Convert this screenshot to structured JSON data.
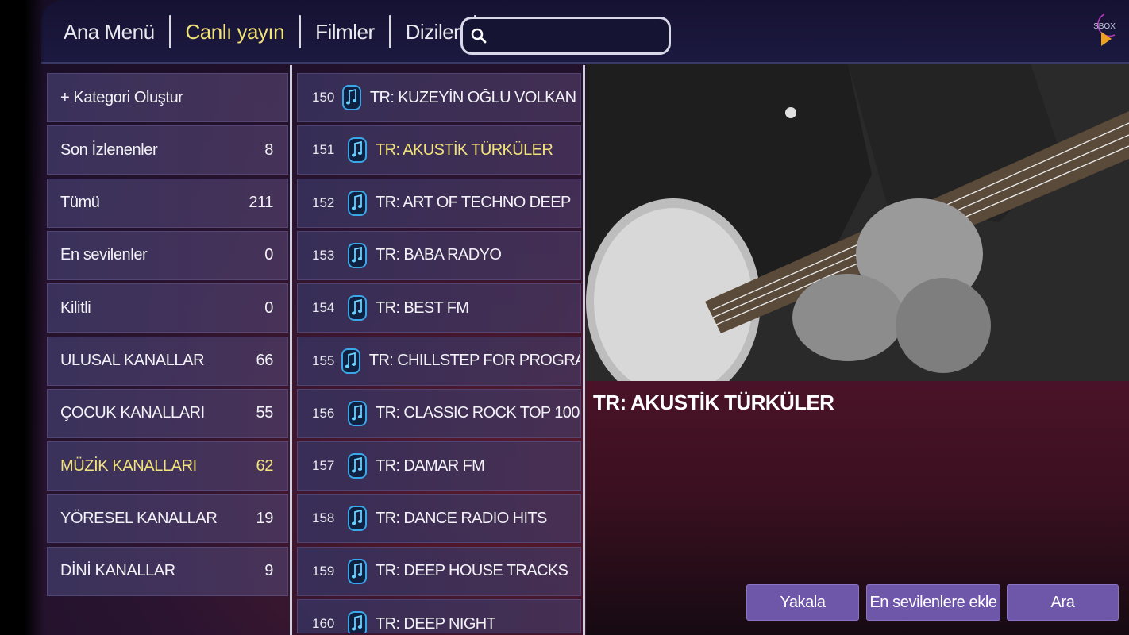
{
  "nav": {
    "items": [
      {
        "label": "Ana Menü"
      },
      {
        "label": "Canlı yayın"
      },
      {
        "label": "Filmler"
      },
      {
        "label": "Diziler"
      }
    ],
    "active_index": 1
  },
  "search": {
    "value": "",
    "placeholder": ""
  },
  "logo": {
    "text": "SBOX",
    "icon": "play-logo-icon"
  },
  "categories": [
    {
      "label": "+ Kategori Oluştur",
      "count": ""
    },
    {
      "label": "Son İzlenenler",
      "count": "8"
    },
    {
      "label": "Tümü",
      "count": "211"
    },
    {
      "label": "En sevilenler",
      "count": "0"
    },
    {
      "label": "Kilitli",
      "count": "0"
    },
    {
      "label": "ULUSAL KANALLAR",
      "count": "66"
    },
    {
      "label": "ÇOCUK KANALLARI",
      "count": "55"
    },
    {
      "label": "MÜZİK KANALLARI",
      "count": "62"
    },
    {
      "label": "YÖRESEL KANALLAR",
      "count": "19"
    },
    {
      "label": "DİNİ KANALLAR",
      "count": "9"
    }
  ],
  "active_category_index": 7,
  "channels": [
    {
      "number": "150",
      "name": "TR: KUZEYİN OĞLU VOLKAN KON..",
      "icon": "music-note-icon"
    },
    {
      "number": "151",
      "name": "TR: AKUSTİK TÜRKÜLER",
      "icon": "music-note-icon"
    },
    {
      "number": "152",
      "name": "TR: ART OF TECHNO DEEP",
      "icon": "music-note-icon"
    },
    {
      "number": "153",
      "name": "TR: BABA RADYO",
      "icon": "music-note-icon"
    },
    {
      "number": "154",
      "name": "TR: BEST FM",
      "icon": "music-note-icon"
    },
    {
      "number": "155",
      "name": "TR: CHILLSTEP FOR PROGRAMME..",
      "icon": "music-note-icon"
    },
    {
      "number": "156",
      "name": "TR: CLASSIC ROCK TOP 100",
      "icon": "music-note-icon"
    },
    {
      "number": "157",
      "name": "TR: DAMAR FM",
      "icon": "music-note-icon"
    },
    {
      "number": "158",
      "name": "TR: DANCE RADIO HITS",
      "icon": "music-note-icon"
    },
    {
      "number": "159",
      "name": "TR: DEEP HOUSE TRACKS",
      "icon": "music-note-icon"
    },
    {
      "number": "160",
      "name": "TR: DEEP NIGHT",
      "icon": "music-note-icon"
    }
  ],
  "active_channel_index": 1,
  "now_playing": {
    "title": "TR: AKUSTİK TÜRKÜLER"
  },
  "actions": {
    "record_label": "Yakala",
    "favorite_label": "En sevilenlere ekle",
    "search_label": "Ara"
  },
  "colors": {
    "accent_yellow": "#f2e27a",
    "button_purple": "#6e56a8",
    "icon_blue": "#3aa8e8"
  }
}
